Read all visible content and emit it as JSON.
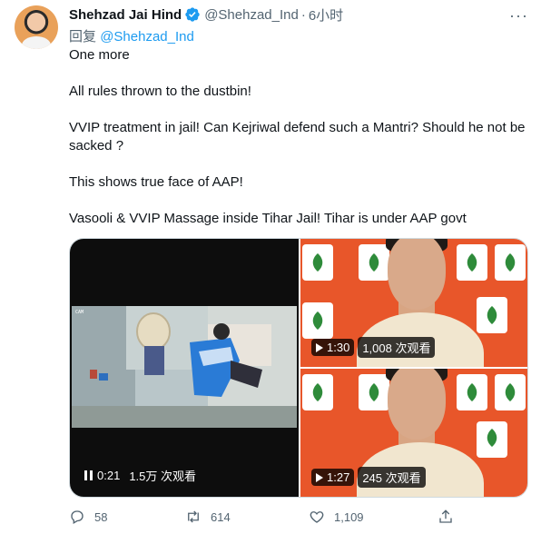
{
  "tweet": {
    "display_name": "Shehzad Jai Hind",
    "handle": "@Shehzad_Ind",
    "separator": "·",
    "time": "6小时",
    "reply_prefix": "回复",
    "reply_to": "@Shehzad_Ind",
    "paragraphs": [
      "One more",
      "All rules thrown to the dustbin!",
      "VVIP treatment in jail! Can Kejriwal defend such a Mantri? Should he not be sacked ?",
      "This shows true face of AAP!",
      "Vasooli & VVIP Massage inside Tihar Jail! Tihar is under AAP govt"
    ]
  },
  "media": {
    "left": {
      "time": "0:21",
      "views": "1.5万 次观看",
      "icon": "pause-icon"
    },
    "right_top": {
      "time": "1:30",
      "views": "1,008 次观看",
      "icon": "play-icon"
    },
    "right_bottom": {
      "time": "1:27",
      "views": "245 次观看",
      "icon": "play-icon"
    },
    "bjp_label": "BJP"
  },
  "actions": {
    "reply_count": "58",
    "retweet_count": "614",
    "like_count": "1,109"
  },
  "colors": {
    "accent": "#1d9bf0",
    "muted": "#536471",
    "text": "#0f1419",
    "bjp_orange": "#e8562a"
  }
}
